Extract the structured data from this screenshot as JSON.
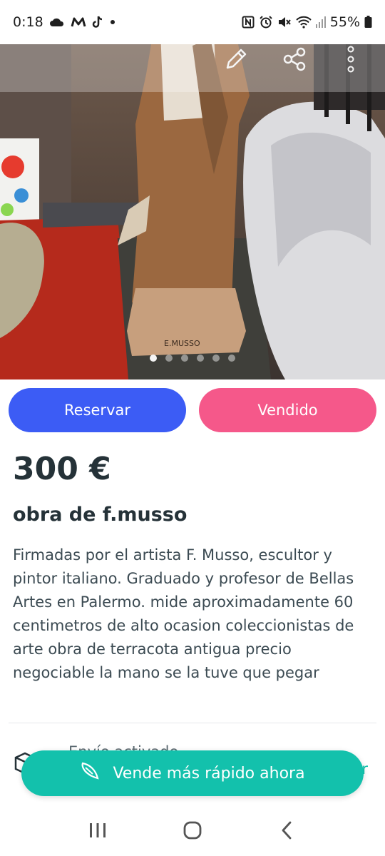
{
  "status_bar": {
    "time": "0:18",
    "battery": "55%",
    "icons": [
      "cloud-icon",
      "movistar-icon",
      "tiktok-icon",
      "dot-icon",
      "nfc-icon",
      "alarm-icon",
      "mute-icon",
      "wifi-icon",
      "signal-icon",
      "battery-icon"
    ]
  },
  "photo": {
    "description_icons": [
      "edit-icon",
      "share-icon",
      "more-icon"
    ],
    "carousel": {
      "count": 6,
      "active_index": 0
    },
    "signature_text": "E.MUSSO"
  },
  "actions": {
    "reserve_label": "Reservar",
    "sold_label": "Vendido",
    "reserve_color": "#3c5cf5",
    "sold_color": "#f5588a"
  },
  "listing": {
    "price": "300 €",
    "title": "obra de f.musso",
    "description": "Firmadas por el artista F. Musso, escultor y pintor italiano. Graduado y profesor de Bellas Artes en Palermo. mide aproximadamente 60 centimetros de alto ocasion coleccionistas de arte obra de terracota antigua precio negociable la mano se la tuve que pegar"
  },
  "shipping": {
    "label": "Envío activado",
    "link_partial": "r"
  },
  "cta": {
    "label": "Vende más rápido ahora",
    "color": "#13c1ac"
  },
  "nav": {
    "icons": [
      "recents-icon",
      "home-icon",
      "back-icon"
    ]
  }
}
